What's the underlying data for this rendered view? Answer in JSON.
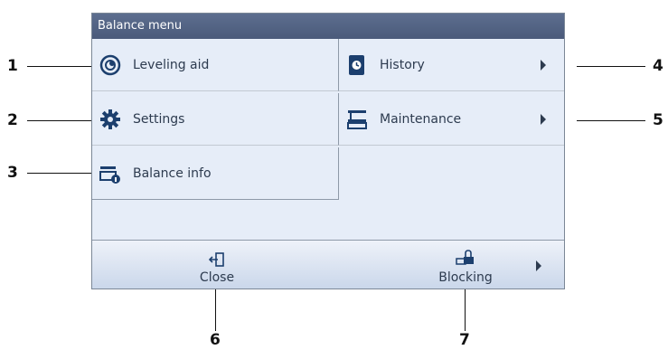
{
  "window": {
    "title": "Balance menu"
  },
  "menu": {
    "leveling": {
      "label": "Leveling aid",
      "icon": "leveling-aid-icon"
    },
    "settings": {
      "label": "Settings",
      "icon": "gear-icon"
    },
    "balance_info": {
      "label": "Balance info",
      "icon": "balance-info-icon"
    },
    "history": {
      "label": "History",
      "icon": "history-icon"
    },
    "maintenance": {
      "label": "Maintenance",
      "icon": "maintenance-icon"
    }
  },
  "footer": {
    "close": {
      "label": "Close",
      "icon": "exit-icon"
    },
    "blocking": {
      "label": "Blocking",
      "icon": "lock-icon"
    }
  },
  "callouts": [
    "1",
    "2",
    "3",
    "4",
    "5",
    "6",
    "7"
  ],
  "colors": {
    "titlebar": "#4a5a7a",
    "background": "#e6edf8",
    "accent": "#1c3f6e"
  }
}
